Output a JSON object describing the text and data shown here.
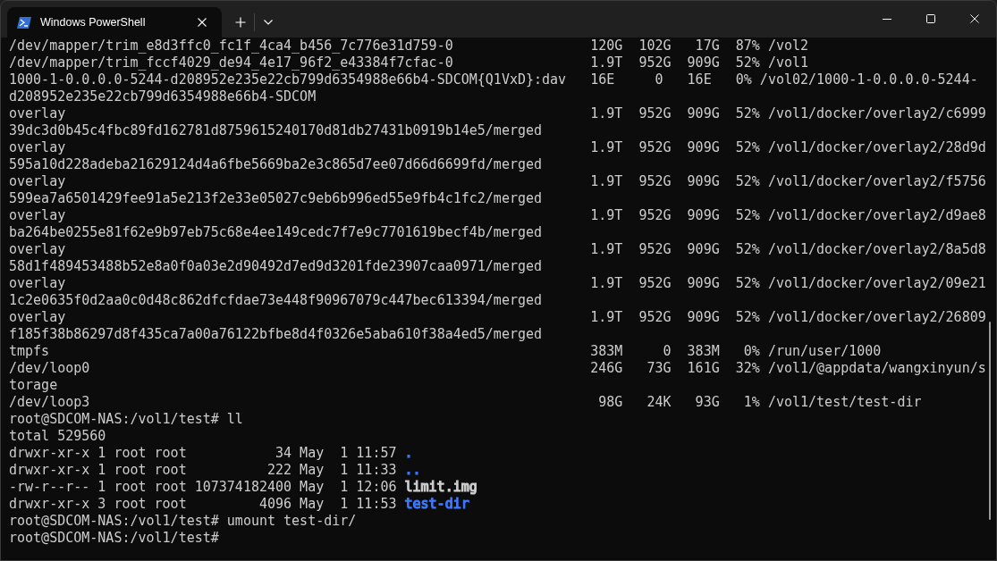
{
  "tabs": [
    {
      "title": "Windows PowerShell",
      "selected": true
    }
  ],
  "lines": [
    {
      "kind": "text",
      "text": "/dev/mapper/trim_e8d3ffc0_fc1f_4ca4_b456_7c776e31d759-0                 120G  102G   17G  87% /vol2"
    },
    {
      "kind": "text",
      "text": "/dev/mapper/trim_fccf4029_de94_4e17_96f2_e43384f7cfac-0                 1.9T  952G  909G  52% /vol1"
    },
    {
      "kind": "text",
      "text": "1000-1-0.0.0.0-5244-d208952e235e22cb799d6354988e66b4-SDCOM{Q1VxD}:dav   16E     0   16E   0% /vol02/1000-1-0.0.0.0-5244-"
    },
    {
      "kind": "text",
      "text": "d208952e235e22cb799d6354988e66b4-SDCOM"
    },
    {
      "kind": "text",
      "text": "overlay                                                                 1.9T  952G  909G  52% /vol1/docker/overlay2/c6999"
    },
    {
      "kind": "text",
      "text": "39dc3d0b45c4fbc89fd162781d8759615240170d81db27431b0919b14e5/merged"
    },
    {
      "kind": "text",
      "text": "overlay                                                                 1.9T  952G  909G  52% /vol1/docker/overlay2/28d9d"
    },
    {
      "kind": "text",
      "text": "595a10d228adeba21629124d4a6fbe5669ba2e3c865d7ee07d66d6699fd/merged"
    },
    {
      "kind": "text",
      "text": "overlay                                                                 1.9T  952G  909G  52% /vol1/docker/overlay2/f5756"
    },
    {
      "kind": "text",
      "text": "599ea7a6501429fee91a5e213f2e33e05027c9eb6b996ed55e9fb4c1fc2/merged"
    },
    {
      "kind": "text",
      "text": "overlay                                                                 1.9T  952G  909G  52% /vol1/docker/overlay2/d9ae8"
    },
    {
      "kind": "text",
      "text": "ba264be0255e81f62e9b97eb75c68e4ee149cedc7f7e9c7701619becf4b/merged"
    },
    {
      "kind": "text",
      "text": "overlay                                                                 1.9T  952G  909G  52% /vol1/docker/overlay2/8a5d8"
    },
    {
      "kind": "text",
      "text": "58d1f489453488b52e8a0f0a03e2d90492d7ed9d3201fde23907caa0971/merged"
    },
    {
      "kind": "text",
      "text": "overlay                                                                 1.9T  952G  909G  52% /vol1/docker/overlay2/09e21"
    },
    {
      "kind": "text",
      "text": "1c2e0635f0d2aa0c0d48c862dfcfdae73e448f90967079c447bec613394/merged"
    },
    {
      "kind": "text",
      "text": "overlay                                                                 1.9T  952G  909G  52% /vol1/docker/overlay2/26809"
    },
    {
      "kind": "text",
      "text": "f185f38b86297d8f435ca7a00a76122bfbe8d4f0326e5aba610f38a4ed5/merged"
    },
    {
      "kind": "text",
      "text": "tmpfs                                                                   383M     0  383M   0% /run/user/1000"
    },
    {
      "kind": "text",
      "text": "/dev/loop0                                                              246G   73G  161G  32% /vol1/@appdata/wangxinyun/s"
    },
    {
      "kind": "text",
      "text": "torage"
    },
    {
      "kind": "text",
      "text": "/dev/loop3                                                               98G   24K   93G   1% /vol1/test/test-dir"
    },
    {
      "kind": "prompt",
      "text": "root@SDCOM-NAS:/vol1/test# ll"
    },
    {
      "kind": "text",
      "text": "total 529560"
    },
    {
      "kind": "ls",
      "text": "drwxr-xr-x 1 root root           34 May  1 11:57",
      "name": ".",
      "color": "#3b78ff"
    },
    {
      "kind": "ls",
      "text": "drwxr-xr-x 1 root root          222 May  1 11:33",
      "name": "..",
      "color": "#3b78ff"
    },
    {
      "kind": "ls",
      "text": "-rw-r--r-- 1 root root 107374182400 May  1 12:06",
      "name": "limit.img",
      "color": "#cccccc"
    },
    {
      "kind": "ls",
      "text": "drwxr-xr-x 3 root root         4096 May  1 11:53",
      "name": "test-dir",
      "color": "#3b78ff"
    },
    {
      "kind": "prompt",
      "text": "root@SDCOM-NAS:/vol1/test# umount test-dir/"
    },
    {
      "kind": "prompt",
      "text": "root@SDCOM-NAS:/vol1/test#"
    }
  ]
}
